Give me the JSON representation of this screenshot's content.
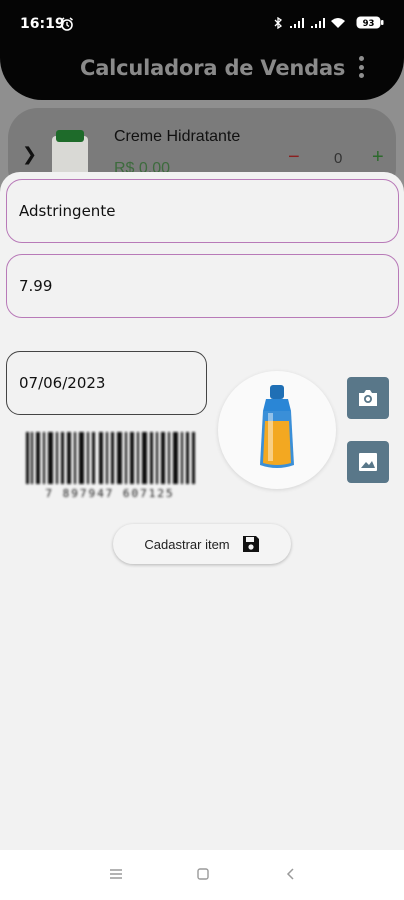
{
  "status_bar": {
    "time": "16:19",
    "battery": "93"
  },
  "app_bar": {
    "title": "Calculadora de Vendas"
  },
  "product_row": {
    "name": "Creme Hidratante",
    "price": "R$ 0,00",
    "quantity": "0",
    "minus": "−",
    "plus": "+"
  },
  "form": {
    "name_value": "Adstringente",
    "price_value": "7.99",
    "date_value": "07/06/2023",
    "barcode_digits": "7 897947 607125",
    "save_label": "Cadastrar item"
  },
  "colors": {
    "accent_border": "#b87ab8",
    "icon_button": "#597789",
    "minus": "#8b2020",
    "plus": "#2c6a2c"
  },
  "icons": {
    "alarm": "alarm-icon",
    "camera": "camera-icon",
    "gallery": "image-icon",
    "save": "floppy-disk-icon",
    "menu": "more-vert-icon"
  }
}
